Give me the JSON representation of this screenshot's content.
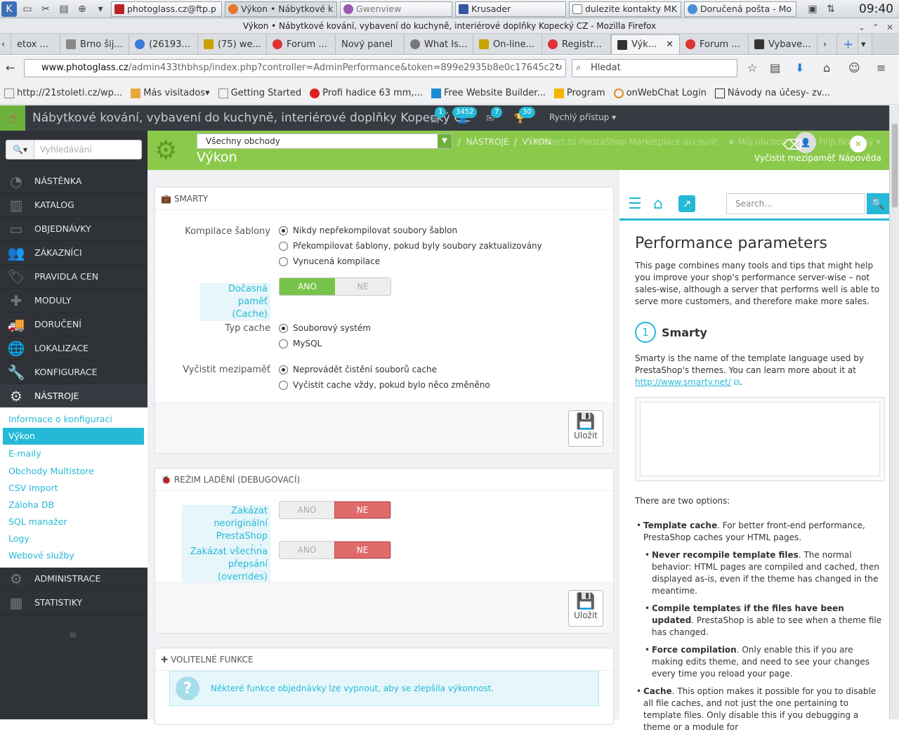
{
  "taskbar": {
    "tasks": [
      "photoglass.cz@ftp.p",
      "Výkon • Nábytkové k",
      "Gwenview",
      "Krusader",
      "dulezite kontakty MK",
      "Doručená pošta - Mo"
    ],
    "clock": "09:40"
  },
  "window": {
    "title": "Výkon • Nábytkové kování, vybavení do kuchyně, interiérové doplňky Kopecký CZ - Mozilla Firefox"
  },
  "tabs": [
    "etox ...",
    "Brno šij...",
    "(26193...",
    "(75) we...",
    "Forum ...",
    "Nový panel",
    "What Is...",
    "On-line...",
    "Registr...",
    "Výk...",
    "Forum ...",
    "Vybave..."
  ],
  "navbar": {
    "url_domain": "www.photoglass.cz",
    "url_rest": "/admin433thbhsp/index.php?controller=AdminPerformance&token=899e2935b8e0c17645c2",
    "search_placeholder": "Hledat"
  },
  "bookmarks": [
    "http://21stoleti.cz/wp...",
    "Más visitados",
    "Getting Started",
    "Profi hadice 63 mm,...",
    "Free Website Builder...",
    "Program",
    "onWebChat Login",
    "Návody na účesy- zv..."
  ],
  "header": {
    "shop_name": "Nábytkové kování, vybavení do kuchyně, interiérové doplňky Kopecký CZ",
    "badges": [
      "1",
      "3452",
      "7",
      "30"
    ],
    "quick_access": "Rychlý přístup"
  },
  "sidebar": {
    "search_placeholder": "Vyhledávání",
    "items": [
      "NÁSTĚNKA",
      "KATALOG",
      "OBJEDNÁVKY",
      "ZÁKAZNÍCI",
      "PRAVIDLA CEN",
      "MODULY",
      "DORUČENÍ",
      "LOKALIZACE",
      "KONFIGURACE",
      "NÁSTROJE",
      "ADMINISTRACE",
      "STATISTIKY"
    ],
    "submenu": [
      "Informace o konfiguraci",
      "Výkon",
      "E-maily",
      "Obchody Multistore",
      "CSV Import",
      "Záloha DB",
      "SQL manažer",
      "Logy",
      "Webové služby"
    ]
  },
  "toolbar": {
    "shop_select": "Všechny obchody",
    "title": "Výkon",
    "crumb1": "NÁSTROJE",
    "crumb2": "VÝKON",
    "faded_links": [
      "Connect to PrestaShop Marketplace account",
      "Můj obchod",
      "Filip Novotný"
    ],
    "clear_cache": "Vyčistit mezipaměť",
    "help": "Nápověda"
  },
  "smarty": {
    "heading": "SMARTY",
    "compile_label": "Kompilace šablony",
    "compile_opts": [
      "Nikdy nepřekompilovat soubory šablon",
      "Překompilovat šablony, pokud byly soubory zaktualizovány",
      "Vynucená kompilace"
    ],
    "cache_label": "Dočasná paměť (Cache)",
    "yes": "ANO",
    "no": "NE",
    "cache_type_label": "Typ cache",
    "cache_type_opts": [
      "Souborový systém",
      "MySQL"
    ],
    "clear_label": "Vyčistit mezipaměť",
    "clear_opts": [
      "Neprovádět čistění souborů cache",
      "Vyčistit cache vždy, pokud bylo něco změněno"
    ],
    "save": "Uložit"
  },
  "debug": {
    "heading": "REŽIM LADĚNÍ (DEBUGOVACÍ)",
    "label1": "Zakázat neoriginální PrestaShop moduly",
    "label2": "Zakázat všechna přepsání (overrides)",
    "yes": "ANO",
    "no": "NE",
    "save": "Uložit"
  },
  "optional": {
    "heading": "VOLITELNÉ FUNKCE",
    "info": "Některé funkce objednávky lze vypnout, aby se zlepšila výkonnost."
  },
  "help": {
    "search_placeholder": "Search...",
    "title": "Performance parameters",
    "intro": "This page combines many tools and tips that might help you improve your shop's performance server-wise – not sales-wise, although a server that performs well is able to serve more customers, and therefore make more sales.",
    "step_num": "1",
    "step_title": "Smarty",
    "smarty_text": "Smarty is the name of the template language used by PrestaShop's themes. You can learn more about it at",
    "smarty_link": "http://www.smarty.net/",
    "two_options": "There are two options:",
    "opt1_bold": "Template cache",
    "opt1_text": ". For better front-end performance, PrestaShop caches your HTML pages.",
    "sub1_bold": "Never recompile template files",
    "sub1_text": ". The normal behavior: HTML pages are compiled and cached, then displayed as-is, even if the theme has changed in the meantime.",
    "sub2_bold": "Compile templates if the files have been updated",
    "sub2_text": ". PrestaShop is able to see when a theme file has changed.",
    "sub3_bold": "Force compilation",
    "sub3_text": ". Only enable this if you are making edits theme, and need to see your changes every time you reload your page.",
    "opt2_bold": "Cache",
    "opt2_text": ". This option makes it possible for you to disable all file caches, and not just the one pertaining to template files. Only disable this if you debugging a theme or a module for"
  },
  "colors": {
    "sidebar": "#2f3338",
    "toolbar": "#8bc94b",
    "accent": "#25b9d7",
    "switch_yes": "#78c34a",
    "switch_no": "#e06a6a"
  }
}
